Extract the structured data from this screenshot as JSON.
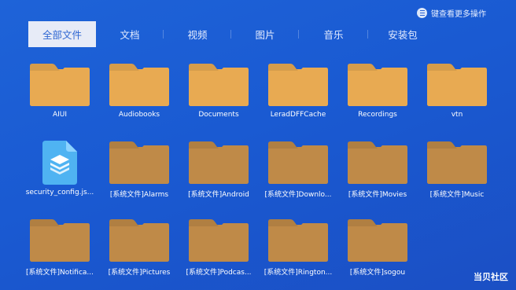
{
  "hint": {
    "text": "键查看更多操作",
    "icon": "menu-icon"
  },
  "tabs": [
    {
      "label": "全部文件",
      "active": true
    },
    {
      "label": "文档",
      "active": false
    },
    {
      "label": "视频",
      "active": false
    },
    {
      "label": "图片",
      "active": false
    },
    {
      "label": "音乐",
      "active": false
    },
    {
      "label": "安装包",
      "active": false
    }
  ],
  "files": [
    {
      "name": "AIUI",
      "type": "folder",
      "color": "#e8aa52"
    },
    {
      "name": "Audiobooks",
      "type": "folder",
      "color": "#e8aa52"
    },
    {
      "name": "Documents",
      "type": "folder",
      "color": "#e8aa52"
    },
    {
      "name": "LeradDFFCache",
      "type": "folder",
      "color": "#e8aa52"
    },
    {
      "name": "Recordings",
      "type": "folder",
      "color": "#e8aa52"
    },
    {
      "name": "vtn",
      "type": "folder",
      "color": "#e8aa52"
    },
    {
      "name": "security_config.js...",
      "type": "document",
      "color": "#4fb3f2"
    },
    {
      "name": "[系统文件]Alarms",
      "type": "folder",
      "color": "#bf8a48"
    },
    {
      "name": "[系统文件]Android",
      "type": "folder",
      "color": "#bf8a48"
    },
    {
      "name": "[系统文件]Downlo...",
      "type": "folder",
      "color": "#bf8a48"
    },
    {
      "name": "[系统文件]Movies",
      "type": "folder",
      "color": "#bf8a48"
    },
    {
      "name": "[系统文件]Music",
      "type": "folder",
      "color": "#bf8a48"
    },
    {
      "name": "[系统文件]Notifica...",
      "type": "folder",
      "color": "#bf8a48"
    },
    {
      "name": "[系统文件]Pictures",
      "type": "folder",
      "color": "#bf8a48"
    },
    {
      "name": "[系统文件]Podcas...",
      "type": "folder",
      "color": "#bf8a48"
    },
    {
      "name": "[系统文件]Rington...",
      "type": "folder",
      "color": "#bf8a48"
    },
    {
      "name": "[系统文件]sogou",
      "type": "folder",
      "color": "#bf8a48"
    }
  ],
  "watermark": "当贝社区"
}
